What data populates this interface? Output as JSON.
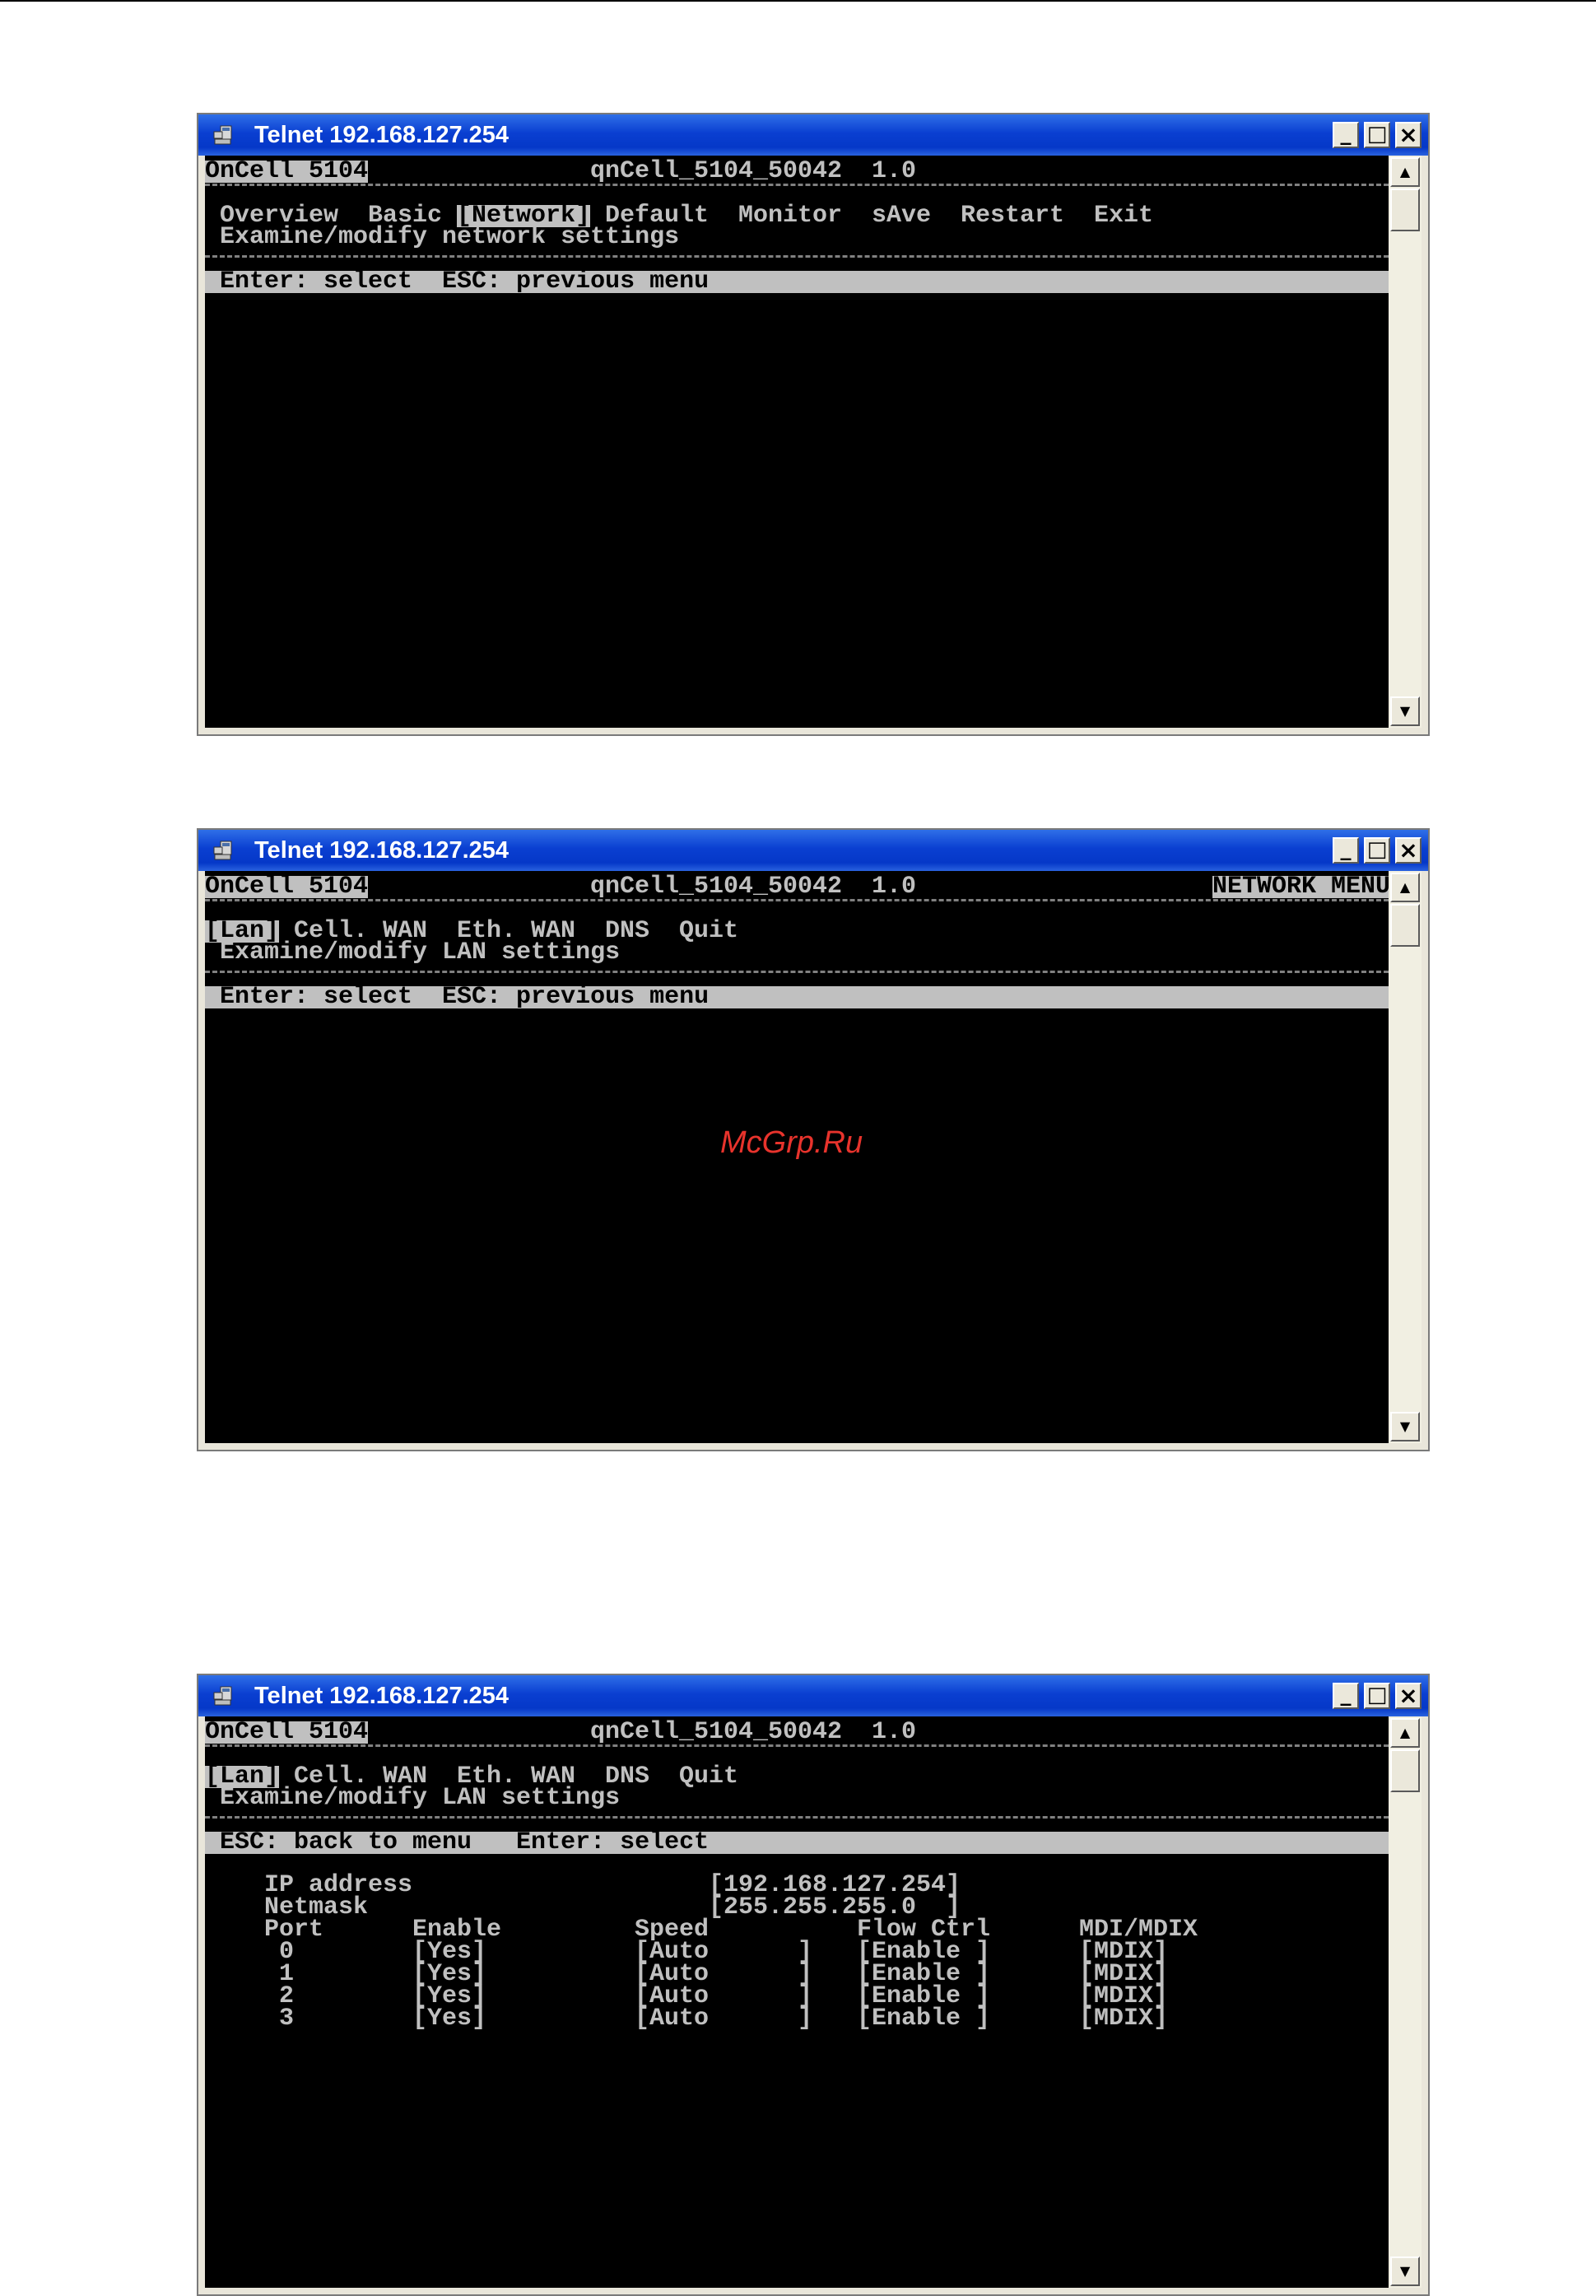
{
  "windows": [
    {
      "title": "Telnet 192.168.127.254",
      "header_left": "OnCell 5104",
      "header_center": "qnCell_5104_50042  1.0",
      "header_right": "",
      "menu": [
        {
          "label": "Overview",
          "selected": false
        },
        {
          "label": "Basic",
          "selected": false
        },
        {
          "label": "[Network]",
          "selected": true
        },
        {
          "label": "Default",
          "selected": false
        },
        {
          "label": "Monitor",
          "selected": false
        },
        {
          "label": "sAve",
          "selected": false
        },
        {
          "label": "Restart",
          "selected": false
        },
        {
          "label": "Exit",
          "selected": false
        }
      ],
      "description": "Examine/modify network settings",
      "status_bar": "Enter: select  ESC: previous menu"
    },
    {
      "title": "Telnet 192.168.127.254",
      "header_left": "OnCell 5104",
      "header_center": "qnCell_5104_50042  1.0",
      "header_right": "NETWORK MENU",
      "menu": [
        {
          "label": "[Lan]",
          "selected": true
        },
        {
          "label": "Cell. WAN",
          "selected": false
        },
        {
          "label": "Eth. WAN",
          "selected": false
        },
        {
          "label": "DNS",
          "selected": false
        },
        {
          "label": "Quit",
          "selected": false
        }
      ],
      "description": "Examine/modify LAN settings",
      "status_bar": "Enter: select  ESC: previous menu"
    },
    {
      "title": "Telnet 192.168.127.254",
      "header_left": "OnCell 5104",
      "header_center": "qnCell_5104_50042  1.0",
      "header_right": "",
      "menu": [
        {
          "label": "[Lan]",
          "selected": true
        },
        {
          "label": "Cell. WAN",
          "selected": false
        },
        {
          "label": "Eth. WAN",
          "selected": false
        },
        {
          "label": "DNS",
          "selected": false
        },
        {
          "label": "Quit",
          "selected": false
        }
      ],
      "description": "Examine/modify LAN settings",
      "status_bar": "ESC: back to menu   Enter: select",
      "lan_settings": {
        "ip_label": "IP address",
        "ip_value": "[192.168.127.254]",
        "netmask_label": "Netmask",
        "netmask_value": "[255.255.255.0  ]",
        "columns": [
          "Port",
          "Enable",
          "Speed",
          "Flow Ctrl",
          "MDI/MDIX"
        ],
        "rows": [
          [
            "0",
            "[Yes]",
            "[Auto      ]",
            "[Enable ]",
            "[MDIX]"
          ],
          [
            "1",
            "[Yes]",
            "[Auto      ]",
            "[Enable ]",
            "[MDIX]"
          ],
          [
            "2",
            "[Yes]",
            "[Auto      ]",
            "[Enable ]",
            "[MDIX]"
          ],
          [
            "3",
            "[Yes]",
            "[Auto      ]",
            "[Enable ]",
            "[MDIX]"
          ]
        ]
      }
    }
  ],
  "watermark": "McGrp.Ru",
  "colors": {
    "title_bar": "#0a3fd1",
    "console_bg": "#000000",
    "console_text": "#c0c0c0",
    "highlight_bg": "#c0c0c0",
    "watermark": "#e8332c"
  },
  "icons": {
    "title": "telnet-computer-icon",
    "minimize": "minimize-icon",
    "maximize": "maximize-icon",
    "close": "close-icon"
  }
}
